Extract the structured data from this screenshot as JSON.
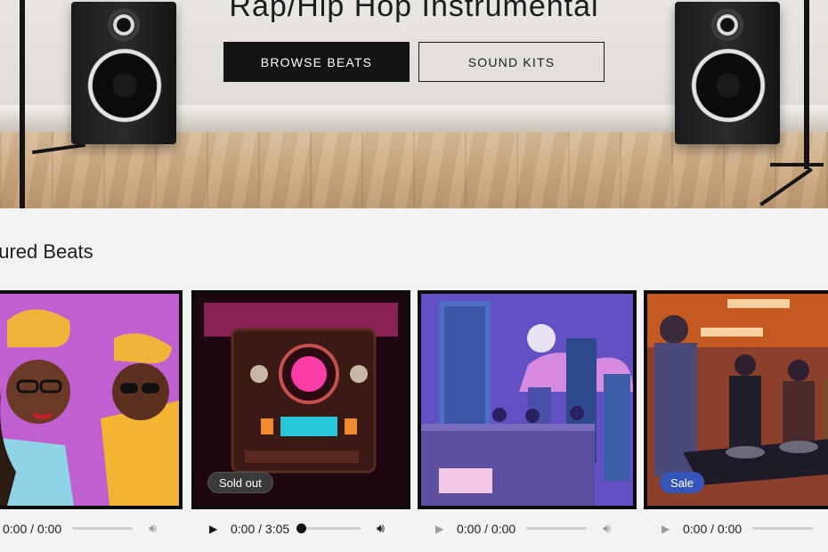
{
  "hero": {
    "title": "Rap/Hip Hop Instrumental",
    "buttons": {
      "browse": "BROWSE BEATS",
      "kits": "SOUND KITS"
    }
  },
  "section": {
    "title": "ıtured Beats"
  },
  "cards": [
    {
      "badge": "",
      "time": "0:00 / 0:00"
    },
    {
      "badge": "Sold out",
      "time": "0:00 / 3:05",
      "progress": 0.0
    },
    {
      "badge": "",
      "time": "0:00 / 0:00"
    },
    {
      "badge": "Sale",
      "time": "0:00 / 0:00"
    }
  ],
  "icons": {
    "play": "play-icon",
    "volume": "volume-icon"
  },
  "colors": {
    "primary_button": "#141414",
    "sale_badge": "#3556b8",
    "soldout_badge": "#3a3a3a"
  }
}
